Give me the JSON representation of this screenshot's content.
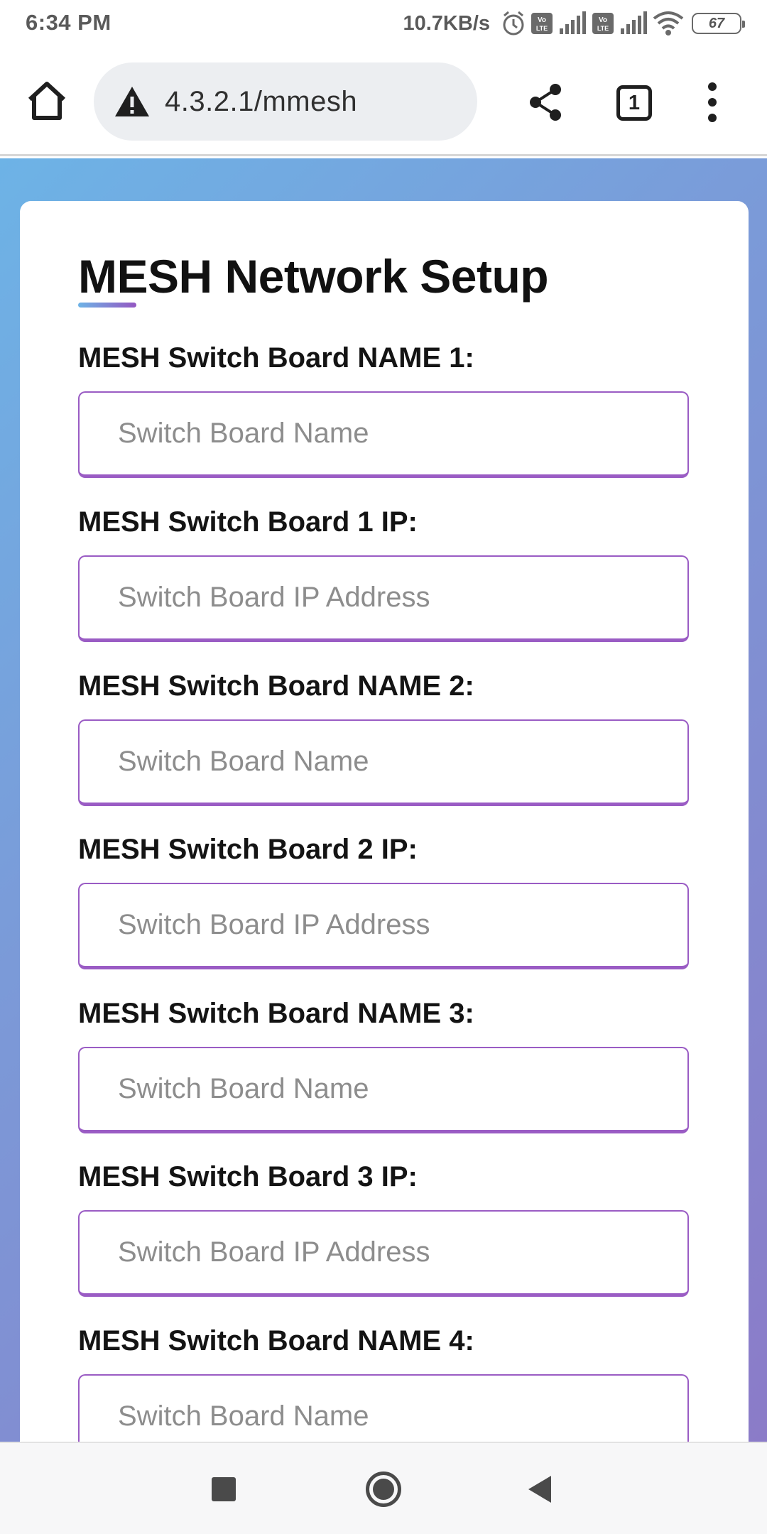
{
  "status_bar": {
    "time": "6:34 PM",
    "net_speed": "10.7KB/s",
    "battery_level": "67",
    "icons": [
      "alarm-icon",
      "volte-icon",
      "signal-icon",
      "volte-icon",
      "signal-icon",
      "wifi-icon",
      "battery-icon"
    ]
  },
  "browser": {
    "url": "4.3.2.1/mmesh",
    "tab_count": "1",
    "icons": [
      "home-icon",
      "warning-icon",
      "share-icon",
      "tabs-icon",
      "more-vert-icon"
    ]
  },
  "page": {
    "title": "MESH Network Setup",
    "accent_colors": [
      "#6db3e6",
      "#9457c2"
    ],
    "fields": [
      {
        "label": "MESH Switch Board NAME 1:",
        "placeholder": "Switch Board Name",
        "value": ""
      },
      {
        "label": "MESH Switch Board 1 IP:",
        "placeholder": "Switch Board IP Address",
        "value": ""
      },
      {
        "label": "MESH Switch Board NAME 2:",
        "placeholder": "Switch Board Name",
        "value": ""
      },
      {
        "label": "MESH Switch Board 2 IP:",
        "placeholder": "Switch Board IP Address",
        "value": ""
      },
      {
        "label": "MESH Switch Board NAME 3:",
        "placeholder": "Switch Board Name",
        "value": ""
      },
      {
        "label": "MESH Switch Board 3 IP:",
        "placeholder": "Switch Board IP Address",
        "value": ""
      },
      {
        "label": "MESH Switch Board NAME 4:",
        "placeholder": "Switch Board Name",
        "value": ""
      }
    ]
  },
  "nav_bar": {
    "icons": [
      "recents-icon",
      "home-circle-icon",
      "back-icon"
    ]
  }
}
